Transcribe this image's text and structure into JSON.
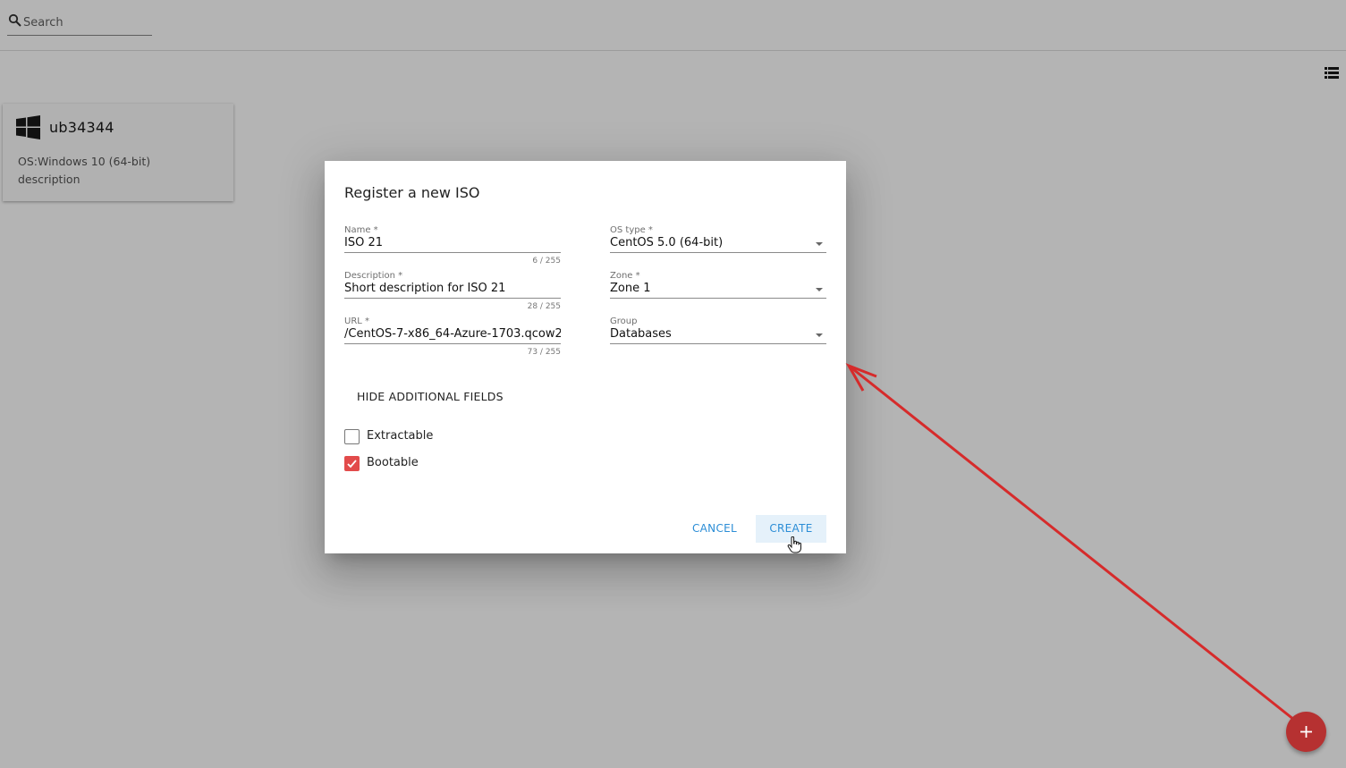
{
  "search": {
    "placeholder": "Search"
  },
  "card": {
    "name": "ub34344",
    "os_line": "OS:Windows 10 (64-bit)",
    "description": "description",
    "logo_icon": "windows-logo-icon"
  },
  "dialog": {
    "title": "Register a new ISO",
    "fields": {
      "name": {
        "label": "Name *",
        "value": "ISO 21",
        "counter": "6 / 255"
      },
      "description": {
        "label": "Description *",
        "value": "Short description for ISO 21",
        "counter": "28 / 255"
      },
      "url": {
        "label": "URL *",
        "value": "/CentOS-7-x86_64-Azure-1703.qcow2",
        "counter": "73 / 255"
      },
      "os_type": {
        "label": "OS type *",
        "value": "CentOS 5.0 (64-bit)"
      },
      "zone": {
        "label": "Zone *",
        "value": "Zone 1"
      },
      "group": {
        "label": "Group",
        "value": "Databases"
      }
    },
    "toggle_label": "HIDE ADDITIONAL FIELDS",
    "checkboxes": {
      "extractable": {
        "label": "Extractable",
        "checked": false
      },
      "bootable": {
        "label": "Bootable",
        "checked": true
      }
    },
    "buttons": {
      "cancel": "CANCEL",
      "create": "CREATE"
    }
  },
  "colors": {
    "accent": "#2b8dd6",
    "checkbox_checked": "#e24b4b",
    "fab": "#b63131",
    "annotation_arrow": "#d62b2b",
    "overlay": "#b4b4b4"
  }
}
